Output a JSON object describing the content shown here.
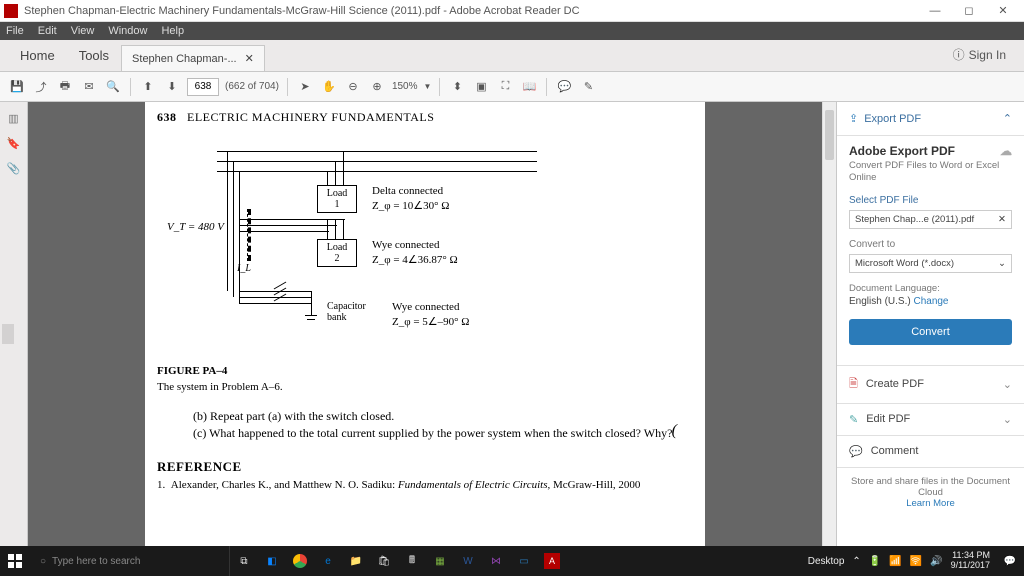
{
  "titlebar": {
    "title": "Stephen Chapman-Electric Machinery Fundamentals-McGraw-Hill Science (2011).pdf - Adobe Acrobat Reader DC"
  },
  "menubar": [
    "File",
    "Edit",
    "View",
    "Window",
    "Help"
  ],
  "tabs": {
    "home": "Home",
    "tools": "Tools",
    "doc": "Stephen Chapman-...",
    "signin": "Sign In"
  },
  "toolbar": {
    "page_current": "638",
    "page_of": "(662 of 704)",
    "zoom": "150%"
  },
  "page": {
    "number": "638",
    "header": "ELECTRIC MACHINERY FUNDAMENTALS",
    "vt": "V_T = 480 V",
    "il": "I_L",
    "load1": "Load\n1",
    "load1_desc1": "Delta connected",
    "load1_desc2": "Z_φ = 10∠30° Ω",
    "load2": "Load\n2",
    "load2_desc1": "Wye connected",
    "load2_desc2": "Z_φ = 4∠36.87° Ω",
    "cap": "Capacitor\nbank",
    "cap_desc1": "Wye connected",
    "cap_desc2": "Z_φ = 5∠–90° Ω",
    "fig_label": "FIGURE PA–4",
    "fig_caption": "The system in Problem A–6.",
    "q_b": "(b)  Repeat part (a) with the switch closed.",
    "q_c": "(c)  What happened to the total current supplied by the power system when the switch closed? Why?",
    "ref_h": "REFERENCE",
    "ref_1": "1.  Alexander, Charles K., and Matthew N. O. Sadiku: Fundamentals of Electric Circuits, McGraw-Hill, 2000"
  },
  "rightpanel": {
    "export": "Export PDF",
    "h1": "Adobe Export PDF",
    "sub": "Convert PDF Files to Word or Excel Online",
    "select_label": "Select PDF File",
    "filename": "Stephen Chap...e (2011).pdf",
    "convert_to": "Convert to",
    "format": "Microsoft Word (*.docx)",
    "lang_label": "Document Language:",
    "lang_value": "English (U.S.)",
    "lang_change": "Change",
    "convert_btn": "Convert",
    "create": "Create PDF",
    "edit": "Edit PDF",
    "comment": "Comment",
    "foot1": "Store and share files in the Document Cloud",
    "foot2": "Learn More"
  },
  "taskbar": {
    "search_placeholder": "Type here to search",
    "desktop": "Desktop",
    "time": "11:34 PM",
    "date": "9/11/2017"
  }
}
